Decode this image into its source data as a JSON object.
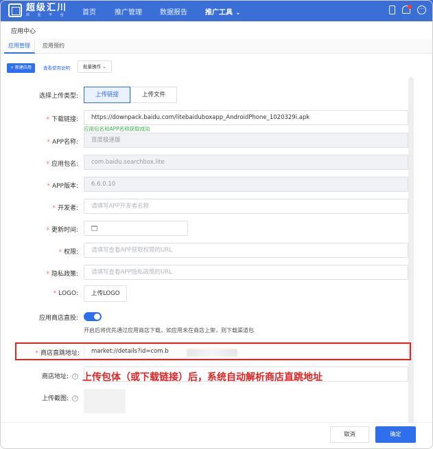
{
  "app": {
    "logo_title": "超级汇川",
    "logo_sub": "商 业 平 台"
  },
  "nav": {
    "items": [
      {
        "label": "首页"
      },
      {
        "label": "推广管理"
      },
      {
        "label": "数据报告"
      },
      {
        "label": "推广工具"
      }
    ],
    "active": "推广工具"
  },
  "page": {
    "title": "应用中心",
    "tabs": [
      {
        "label": "应用管理",
        "active": true
      },
      {
        "label": "应用预约",
        "active": false
      }
    ]
  },
  "toolbar": {
    "new_app": "+ 新建应用",
    "guide": "查看使用说明",
    "batch": "批量操作"
  },
  "form": {
    "upload_type": {
      "label": "选择上传类型:",
      "options": [
        "上传链接",
        "上传文件"
      ],
      "selected": "上传链接"
    },
    "download_link": {
      "label": "下载链接:",
      "value": "https://downpack.baidu.com/litebaiduboxapp_AndroidPhone_1020329i.apk",
      "hint": "应用包名和APP名称获取成功"
    },
    "app_name": {
      "label": "APP名称:",
      "value": "百度极速版"
    },
    "package_name": {
      "label": "应用包名:",
      "value": "com.baidu.searchbox.lite"
    },
    "app_version": {
      "label": "APP版本:",
      "value": "6.6.0.10"
    },
    "developer": {
      "label": "开发者:",
      "placeholder": "请填写APP开发者名称"
    },
    "update_time": {
      "label": "更新时间:"
    },
    "permissions": {
      "label": "权限:",
      "placeholder": "请填写查看APP获取权限的URL"
    },
    "privacy": {
      "label": "隐私政策:",
      "placeholder": "请填写查看APP隐私政策的URL"
    },
    "logo": {
      "label": "LOGO:",
      "button": "上传LOGO"
    },
    "store_direct": {
      "label": "应用商店直投:",
      "enabled": true,
      "hint": "开启后将优先通过应用商店下载，如应用未在商店上架，则下载渠道包"
    },
    "store_jump": {
      "label": "商店直跳地址:",
      "value": "market://details?id=com.b"
    },
    "store_address": {
      "label": "商店地址:"
    },
    "screenshots": {
      "label": "上传截图:"
    }
  },
  "annotation": "上传包体（或下载链接）后，系统自动解析商店直跳地址",
  "footer": {
    "cancel": "取消",
    "confirm": "确定"
  },
  "colors": {
    "primary": "#2f6fed",
    "topbar": "#3a6fd8",
    "highlight": "#e02424",
    "success": "#3bb34a"
  }
}
